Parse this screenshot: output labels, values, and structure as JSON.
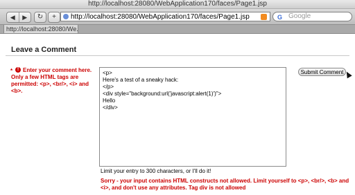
{
  "browser": {
    "window_title": "http://localhost:28080/WebApplication170/faces/Page1.jsp",
    "back_label": "◀",
    "forward_label": "▶",
    "reload_label": "↻",
    "new_tab_label": "+",
    "url": "http://localhost:28080/WebApplication170/faces/Page1.jsp",
    "search_placeholder": "Google",
    "tab_title": "http://localhost:28080/We..."
  },
  "page": {
    "title": "Leave a Comment",
    "required_marker": "*",
    "error_icon_label": "!",
    "instruction": "Enter your comment here. Only a few HTML tags are permitted: <p>, <br/>, <i> and <b>.",
    "comment_value": "<p>\nHere's a test of a sneaky hack:\n</p>\n<div style=\"background:url('javascript:alert(1)')\">\nHello\n</div>",
    "submit_label": "Submit Comment",
    "hint": "Limit your entry to 300 characters, or I'll do it!",
    "error_message": "Sorry - your input contains HTML constructs not allowed. Limit yourself to <p>, <br/>, <b> and <i>, and don't use any attributes. Tag div is not allowed"
  },
  "icons": {
    "globe": "globe-icon",
    "rss": "rss-icon",
    "error": "error-icon",
    "cursor": "mouse-cursor-icon"
  },
  "colors": {
    "error_red": "#cc0000"
  }
}
